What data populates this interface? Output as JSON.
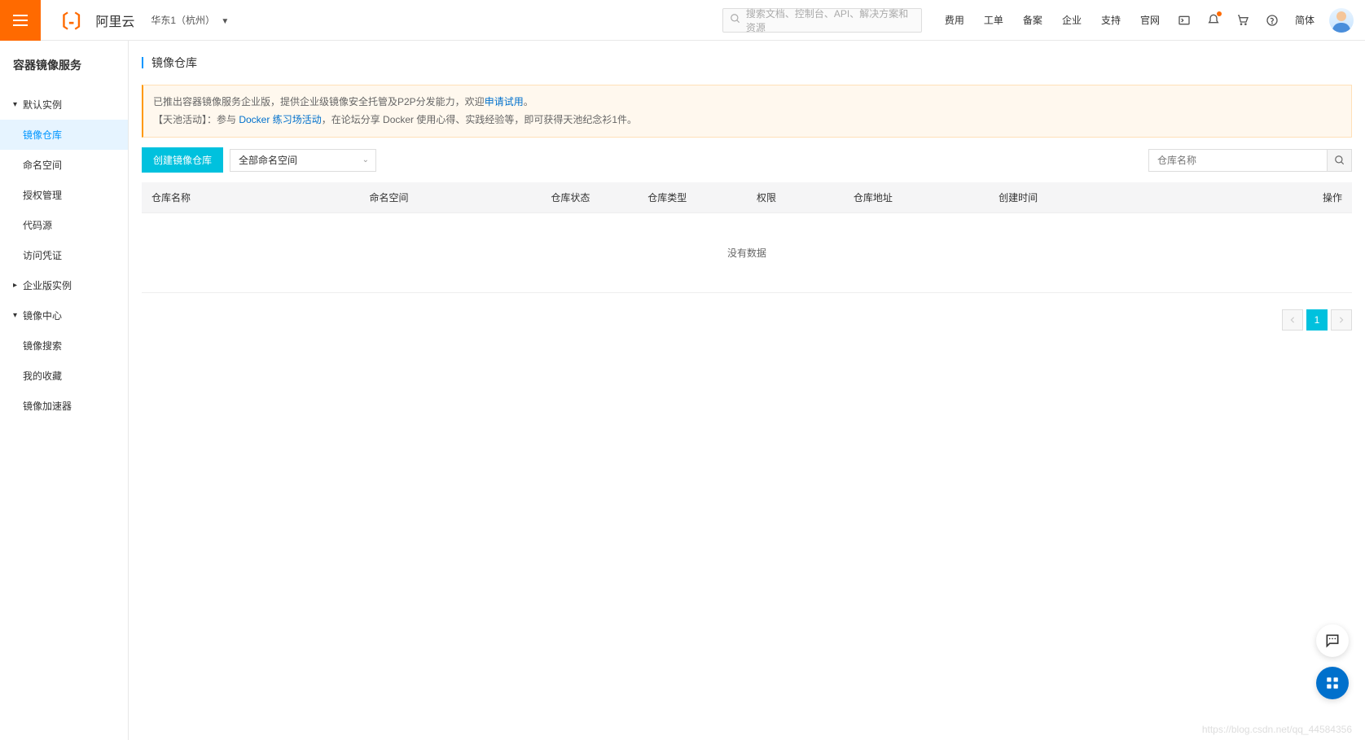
{
  "header": {
    "logo_text": "阿里云",
    "region": "华东1（杭州）",
    "search_placeholder": "搜索文档、控制台、API、解决方案和资源",
    "nav": [
      "费用",
      "工单",
      "备案",
      "企业",
      "支持",
      "官网"
    ],
    "lang": "简体"
  },
  "sidebar": {
    "service_title": "容器镜像服务",
    "groups": [
      {
        "label": "默认实例",
        "expanded": true,
        "items": [
          {
            "label": "镜像仓库",
            "active": true
          },
          {
            "label": "命名空间",
            "active": false
          },
          {
            "label": "授权管理",
            "active": false
          },
          {
            "label": "代码源",
            "active": false
          },
          {
            "label": "访问凭证",
            "active": false
          }
        ]
      },
      {
        "label": "企业版实例",
        "expanded": false,
        "items": []
      },
      {
        "label": "镜像中心",
        "expanded": true,
        "items": [
          {
            "label": "镜像搜索",
            "active": false
          },
          {
            "label": "我的收藏",
            "active": false
          },
          {
            "label": "镜像加速器",
            "active": false
          }
        ]
      }
    ]
  },
  "main": {
    "page_title": "镜像仓库",
    "notice": {
      "line1_pre": "已推出容器镜像服务企业版，提供企业级镜像安全托管及P2P分发能力，欢迎",
      "line1_link": "申请试用",
      "line1_post": "。",
      "line2_pre": "【天池活动】：参与 ",
      "line2_link": "Docker 练习场活动",
      "line2_post": "，在论坛分享 Docker 使用心得、实践经验等，即可获得天池纪念衫1件。"
    },
    "toolbar": {
      "create_button": "创建镜像仓库",
      "namespace_filter": "全部命名空间",
      "search_placeholder": "仓库名称"
    },
    "table": {
      "headers": [
        "仓库名称",
        "命名空间",
        "仓库状态",
        "仓库类型",
        "权限",
        "仓库地址",
        "创建时间",
        "操作"
      ],
      "empty_text": "没有数据"
    },
    "pagination": {
      "current": "1"
    }
  },
  "watermark": "https://blog.csdn.net/qq_44584356"
}
